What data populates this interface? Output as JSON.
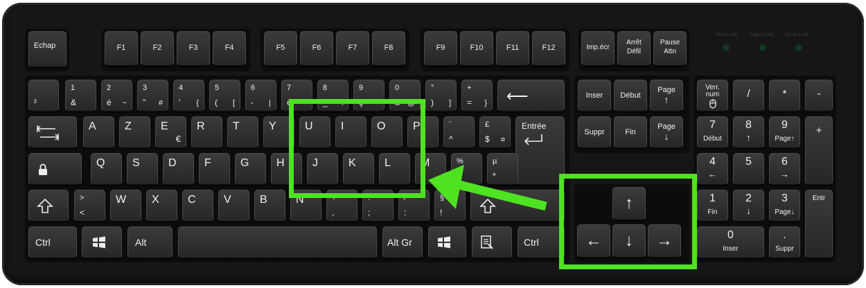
{
  "keyboard": {
    "esc": "Echap",
    "fkeys": [
      "F1",
      "F2",
      "F3",
      "F4",
      "F5",
      "F6",
      "F7",
      "F8",
      "F9",
      "F10",
      "F11",
      "F12"
    ],
    "system": {
      "print": "Imp.écr",
      "scroll_top": "Arrêt",
      "scroll_bottom": "Défil",
      "pause_top": "Pause",
      "pause_bottom": "Attn"
    },
    "leds": [
      "Num Lock",
      "Caps Lock",
      "Scroll Lock"
    ],
    "number_row": [
      {
        "top": "",
        "bottom": "²"
      },
      {
        "top": "1",
        "bottom": "&"
      },
      {
        "top": "2",
        "bottom": "é",
        "alt": "~"
      },
      {
        "top": "3",
        "bottom": "\"",
        "alt": "#"
      },
      {
        "top": "4",
        "bottom": "'",
        "alt": "{"
      },
      {
        "top": "5",
        "bottom": "(",
        "alt": "["
      },
      {
        "top": "6",
        "bottom": "-",
        "alt": "|"
      },
      {
        "top": "7",
        "bottom": "è",
        "alt": "`"
      },
      {
        "top": "8",
        "bottom": "_",
        "alt": "\\"
      },
      {
        "top": "9",
        "bottom": "ç",
        "alt": "^"
      },
      {
        "top": "0",
        "bottom": "à",
        "alt": "@"
      },
      {
        "top": "°",
        "bottom": ")",
        "alt": "]"
      },
      {
        "top": "+",
        "bottom": "=",
        "alt": "}"
      }
    ],
    "backspace": "⟵",
    "row_a": [
      "A",
      "Z",
      "E",
      "R",
      "T",
      "Y",
      "U",
      "I",
      "O",
      "P"
    ],
    "euro": "€",
    "trema": {
      "top": "¨",
      "bottom": "^"
    },
    "pound": {
      "top": "£",
      "bottom": "$",
      "alt": "¤"
    },
    "enter": "Entrée",
    "row_q": [
      "Q",
      "S",
      "D",
      "F",
      "G",
      "H",
      "J",
      "K",
      "L",
      "M"
    ],
    "percent": {
      "top": "%",
      "bottom": "ù"
    },
    "mu": {
      "top": "µ",
      "bottom": "*"
    },
    "row_w_extra": {
      "top": ">",
      "bottom": "<"
    },
    "row_w": [
      "W",
      "X",
      "C",
      "V",
      "B",
      "N"
    ],
    "row_w_punct": [
      {
        "top": "?",
        "bottom": ","
      },
      {
        "top": ".",
        "bottom": ";"
      },
      {
        "top": "/",
        "bottom": ":"
      },
      {
        "top": "§",
        "bottom": "!"
      }
    ],
    "bottom": {
      "ctrl": "Ctrl",
      "alt": "Alt",
      "altgr": "Alt Gr"
    },
    "nav": {
      "insert": "Inser",
      "home": "Début",
      "pgup_top": "Page",
      "pgup_arrow": "↑",
      "delete": "Suppr",
      "end": "Fin",
      "pgdn_top": "Page",
      "pgdn_arrow": "↓"
    },
    "arrows": {
      "up": "↑",
      "down": "↓",
      "left": "←",
      "right": "→"
    },
    "numpad": {
      "numlock_top": "Verr.",
      "numlock_bottom": "num",
      "divide": "/",
      "multiply": "*",
      "minus": "-",
      "plus": "+",
      "enter": "Entr",
      "k7": "7",
      "k7s": "Début",
      "k8": "8",
      "k8s": "↑",
      "k9": "9",
      "k9s": "Page↑",
      "k4": "4",
      "k4s": "←",
      "k5": "5",
      "k6": "6",
      "k6s": "→",
      "k1": "1",
      "k1s": "Fin",
      "k2": "2",
      "k2s": "↓",
      "k3": "3",
      "k3s": "Page↓",
      "k0": "0",
      "k0s": "Inser",
      "dot": ".",
      "dots": "Suppr"
    }
  },
  "highlight": {
    "color": "#4fe221"
  }
}
